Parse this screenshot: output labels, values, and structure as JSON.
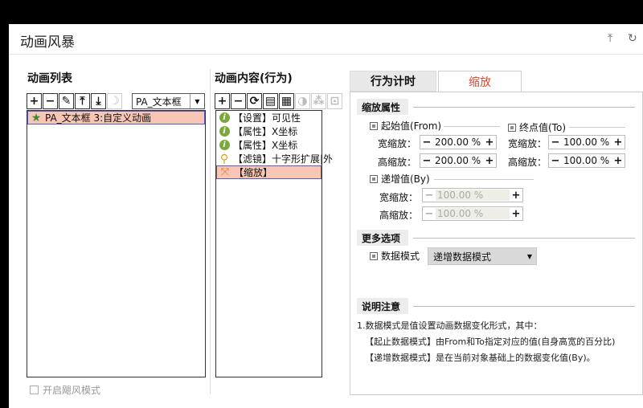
{
  "window": {
    "title": "动画风暴"
  },
  "left_panel": {
    "title": "动画列表",
    "toolbar": [
      {
        "icon": "plus-icon",
        "glyph": "+"
      },
      {
        "icon": "minus-icon",
        "glyph": "−"
      },
      {
        "icon": "brush-icon",
        "glyph": "✎"
      },
      {
        "icon": "move-top-icon",
        "glyph": "⤒"
      },
      {
        "icon": "move-bottom-icon",
        "glyph": "⤓"
      },
      {
        "icon": "moon-icon",
        "glyph": "☽"
      }
    ],
    "object_combo": "PA_文本框",
    "items": [
      {
        "icon": "star-icon",
        "label": "PA_文本框 3:自定义动画",
        "selected": true
      }
    ],
    "checkbox_label": "开启飓风模式"
  },
  "middle_panel": {
    "title": "动画内容(行为)",
    "toolbar": [
      {
        "icon": "plus-icon",
        "glyph": "+"
      },
      {
        "icon": "minus-icon",
        "glyph": "−"
      },
      {
        "icon": "refresh-icon",
        "glyph": "⟳"
      },
      {
        "icon": "copy-icon",
        "glyph": "▤"
      },
      {
        "icon": "paste-icon",
        "glyph": "▦"
      },
      {
        "icon": "contrast-icon",
        "glyph": "◑"
      },
      {
        "icon": "nodes-icon",
        "glyph": "⁂"
      },
      {
        "icon": "frame-icon",
        "glyph": "⊡"
      }
    ],
    "items": [
      {
        "icon": "info-icon",
        "label": "【设置】可见性",
        "selected": false
      },
      {
        "icon": "info-icon",
        "label": "【属性】X坐标",
        "selected": false
      },
      {
        "icon": "info-icon",
        "label": "【属性】X坐标",
        "selected": false
      },
      {
        "icon": "search-icon",
        "label": "【滤镜】十字形扩展|外",
        "selected": false
      },
      {
        "icon": "scale-icon",
        "label": "【缩放】",
        "selected": true
      }
    ]
  },
  "tabs": [
    {
      "label": "行为计时",
      "active": false
    },
    {
      "label": "缩放",
      "active": true
    }
  ],
  "scale": {
    "section_title": "缩放属性",
    "from": {
      "label": "起始值(From)",
      "width_label": "宽缩放：",
      "width_value": "200.00 %",
      "height_label": "高缩放：",
      "height_value": "200.00 %"
    },
    "to": {
      "label": "终点值(To)",
      "width_label": "宽缩放：",
      "width_value": "100.00 %",
      "height_label": "高缩放：",
      "height_value": "100.00 %"
    },
    "by": {
      "label": "递增值(By)",
      "width_label": "宽缩放：",
      "width_value": "100.00 %",
      "height_label": "高缩放：",
      "height_value": "100.00 %"
    }
  },
  "more": {
    "section_title": "更多选项",
    "data_mode_label": "数据模式",
    "data_mode_value": "递增数据模式"
  },
  "notes": {
    "section_title": "说明注意",
    "line1": "1.数据模式是值设置动画数据变化形式，其中：",
    "line2": "【起止数据模式】由From和To指定对应的值(自身高宽的百分比)",
    "line3": "【递增数据模式】是在当前对象基础上的数据变化值(By)。"
  }
}
